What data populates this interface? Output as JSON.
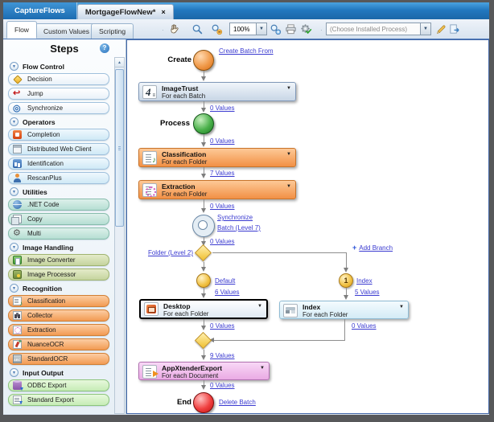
{
  "window": {
    "app_tab": "CaptureFlows",
    "doc_tab": "MortgageFlowNew*",
    "close": "×"
  },
  "tabs": {
    "flow": "Flow",
    "custom_values": "Custom Values",
    "scripting": "Scripting"
  },
  "toolbar": {
    "zoom_value": "100%",
    "process_placeholder": "(Choose Installed Process)",
    "icons": [
      "pan-hand",
      "zoom-select",
      "zoom-out",
      "zoom-in",
      "print",
      "validate-gear",
      "edit-pencil",
      "export-flow"
    ]
  },
  "sidebar": {
    "title": "Steps",
    "help": "?",
    "sections": [
      {
        "label": "Flow Control",
        "items": [
          {
            "label": "Decision",
            "icon": "decision-diamond-icon"
          },
          {
            "label": "Jump",
            "icon": "jump-arrow-icon"
          },
          {
            "label": "Synchronize",
            "icon": "synchronize-ring-icon"
          }
        ]
      },
      {
        "label": "Operators",
        "items": [
          {
            "label": "Completion",
            "icon": "completion-icon"
          },
          {
            "label": "Distributed Web Client",
            "icon": "web-client-icon"
          },
          {
            "label": "Identification",
            "icon": "identification-icon"
          },
          {
            "label": "RescanPlus",
            "icon": "rescan-person-icon"
          }
        ]
      },
      {
        "label": "Utilities",
        "items": [
          {
            "label": ".NET Code",
            "icon": "dotnet-globe-icon"
          },
          {
            "label": "Copy",
            "icon": "copy-icon"
          },
          {
            "label": "Multi",
            "icon": "multi-gear-icon"
          }
        ]
      },
      {
        "label": "Image Handling",
        "items": [
          {
            "label": "Image Converter",
            "icon": "image-converter-icon"
          },
          {
            "label": "Image Processor",
            "icon": "image-processor-icon"
          }
        ]
      },
      {
        "label": "Recognition",
        "items": [
          {
            "label": "Classification",
            "icon": "classification-doc-icon"
          },
          {
            "label": "Collector",
            "icon": "collector-icon"
          },
          {
            "label": "Extraction",
            "icon": "extraction-doc-icon"
          },
          {
            "label": "NuanceOCR",
            "icon": "nuance-ocr-icon"
          },
          {
            "label": "StandardOCR",
            "icon": "standard-ocr-icon"
          }
        ]
      },
      {
        "label": "Input Output",
        "items": [
          {
            "label": "ODBC Export",
            "icon": "odbc-export-icon"
          },
          {
            "label": "Standard Export",
            "icon": "standard-export-icon"
          }
        ]
      }
    ]
  },
  "flow": {
    "create": {
      "label": "Create",
      "link": "Create Batch From"
    },
    "imagetrust": {
      "title": "ImageTrust",
      "subtitle": "For each Batch",
      "values": "0 Values"
    },
    "process": {
      "label": "Process",
      "values": "0 Values"
    },
    "classification": {
      "title": "Classification",
      "subtitle": "For each Folder",
      "values": "7 Values"
    },
    "extraction": {
      "title": "Extraction",
      "subtitle": "For each Folder",
      "values": "0 Values"
    },
    "synchronize": {
      "link_line1": "Synchronize",
      "link_line2": "Batch (Level 7)",
      "values": "0 Values"
    },
    "decision": {
      "link": "Folder (Level 2)",
      "plus": "+",
      "add_branch": "Add Branch"
    },
    "branch_default": {
      "link": "Default",
      "values": "6 Values"
    },
    "branch_index": {
      "badge": "1",
      "link": "Index",
      "values": "5 Values"
    },
    "desktop": {
      "title": "Desktop",
      "subtitle": "For each Folder",
      "values": "0 Values"
    },
    "index_step": {
      "title": "Index",
      "subtitle": "For each Folder",
      "values": "0 Values"
    },
    "merge": {
      "values": "9 Values"
    },
    "appxtender": {
      "title": "AppXtenderExport",
      "subtitle": "For each Document",
      "values": "0 Values"
    },
    "end": {
      "label": "End",
      "link": "Delete Batch"
    }
  },
  "colors": {
    "accent_blue": "#1e72b8",
    "node_orange": "#f29045",
    "node_cyan": "#d4ebf6",
    "node_pink": "#eaaae4",
    "link_blue": "#3a3ad0",
    "gold": "#f0c030"
  }
}
